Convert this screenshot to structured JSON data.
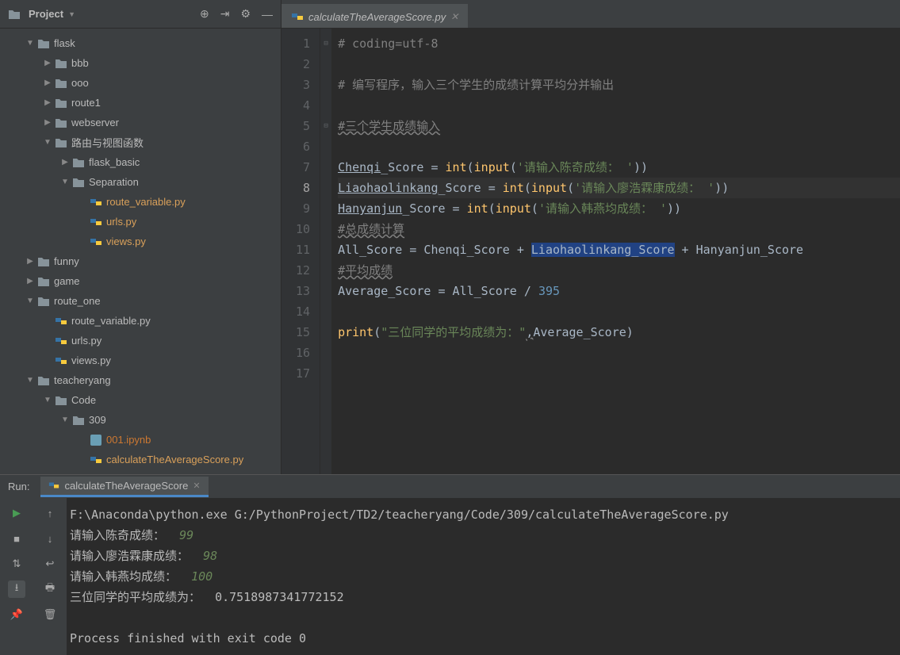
{
  "project": {
    "label": "Project"
  },
  "tree": {
    "flask": "flask",
    "bbb": "bbb",
    "ooo": "ooo",
    "route1": "route1",
    "webserver": "webserver",
    "rvf": "路由与视图函数",
    "flask_basic": "flask_basic",
    "separation": "Separation",
    "route_variable": "route_variable.py",
    "urls": "urls.py",
    "views": "views.py",
    "funny": "funny",
    "game": "game",
    "route_one": "route_one",
    "teacheryang": "teacheryang",
    "code": "Code",
    "n309": "309",
    "ipynb": "001.ipynb",
    "calc": "calculateTheAverageScore.py"
  },
  "tab": {
    "name": "calculateTheAverageScore.py"
  },
  "gutters": [
    "1",
    "2",
    "3",
    "4",
    "5",
    "6",
    "7",
    "8",
    "9",
    "10",
    "11",
    "12",
    "13",
    "14",
    "15",
    "16",
    "17"
  ],
  "code": {
    "l1": "# coding=utf-8",
    "l3": "# 编写程序，输入三个学生的成绩计算平均分并输出",
    "l5": "#三个学生成绩输入",
    "l7a": "Chenqi",
    "l7b": "_Score = ",
    "l7c": "int",
    "l7d": "(",
    "l7e": "input",
    "l7f": "(",
    "l7g": "'请输入陈奇成绩： '",
    "l7h": "))",
    "l8a": "Liaohaolinkang",
    "l8b": "_Score = ",
    "l8c": "int",
    "l8d": "(",
    "l8e": "input",
    "l8f": "(",
    "l8g": "'请输入廖浩霖康成绩： '",
    "l8h": "))",
    "l9a": "Hanyanjun",
    "l9b": "_Score = ",
    "l9c": "int",
    "l9d": "(",
    "l9e": "input",
    "l9f": "(",
    "l9g": "'请输入韩燕均成绩： '",
    "l9h": "))",
    "l10": "#总成绩计算",
    "l11a": "All_Score = Chenqi_Score + ",
    "l11b": "Liaohaolinkang_Score",
    "l11c": " + Hanyanjun_Score",
    "l12": "#平均成绩",
    "l13a": "Average_Score = All_Score / ",
    "l13b": "395",
    "l15a": "print",
    "l15b": "(",
    "l15c": "\"三位同学的平均成绩为：\"",
    "l15d": ",",
    "l15e": "Average_Score)"
  },
  "run": {
    "label": "Run:",
    "tab": "calculateTheAverageScore",
    "l1": "F:\\Anaconda\\python.exe G:/PythonProject/TD2/teacheryang/Code/309/calculateTheAverageScore.py",
    "l2a": "请输入陈奇成绩：  ",
    "l2b": "99",
    "l3a": "请输入廖浩霖康成绩：  ",
    "l3b": "98",
    "l4a": "请输入韩燕均成绩：  ",
    "l4b": "100",
    "l5": "三位同学的平均成绩为：  0.7518987341772152",
    "l6": "Process finished with exit code 0"
  }
}
